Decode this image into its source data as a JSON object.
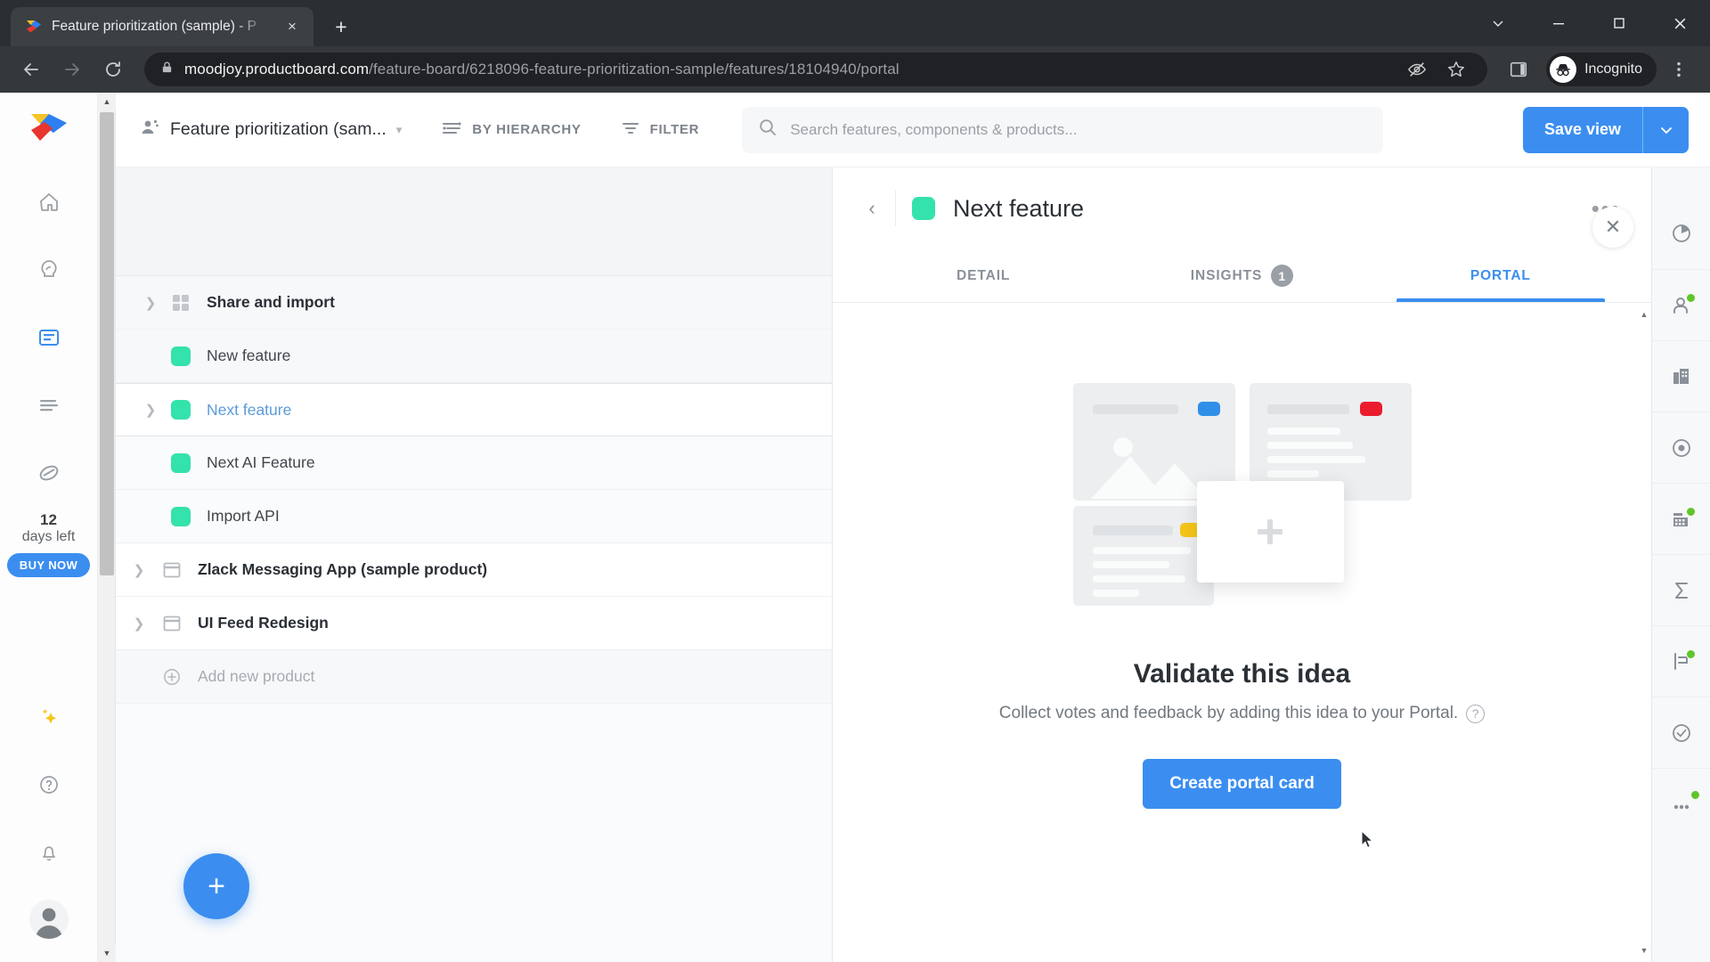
{
  "browser": {
    "tab": {
      "title": "Feature prioritization (sample) - P",
      "favicon": "productboard-favicon",
      "close": "×"
    },
    "newtab_label": "+",
    "window_controls": {
      "minimize_group": "⌄",
      "minimize": "–",
      "maximize": "❐",
      "close": "✕"
    },
    "nav": {
      "back": "←",
      "forward": "→",
      "reload": "⟳"
    },
    "omnibox": {
      "lock_icon": "lock-icon",
      "url_host": "moodjoy.productboard.com",
      "url_path": "/feature-board/6218096-feature-prioritization-sample/features/18104940/portal"
    },
    "actions": {
      "no_tracking": "no-tracking-icon",
      "bookmark": "☆",
      "side_panel": "side-panel-icon",
      "menu": "⋮"
    },
    "profile": {
      "name": "Incognito",
      "avatar": "incognito-avatar"
    }
  },
  "left_rail": {
    "brand": "productboard-logo",
    "items": [
      {
        "name": "home",
        "active": false
      },
      {
        "name": "insights",
        "active": false
      },
      {
        "name": "features",
        "active": true
      },
      {
        "name": "roadmap",
        "active": false
      },
      {
        "name": "objectives",
        "active": false
      }
    ],
    "trial": {
      "days": "12",
      "label": "days left",
      "cta": "BUY NOW"
    },
    "bottom": [
      {
        "name": "ai-sparkle"
      },
      {
        "name": "help"
      },
      {
        "name": "notifications"
      },
      {
        "name": "user-avatar"
      }
    ]
  },
  "topbar": {
    "view_name": "Feature prioritization (sam...",
    "view_caret": "▾",
    "hierarchy_label": "BY HIERARCHY",
    "filter_label": "FILTER",
    "search_placeholder": "Search features, components & products...",
    "save_label": "Save view",
    "save_caret": "⌄"
  },
  "board": {
    "rows": [
      {
        "label": "Share and import",
        "type": "component",
        "caret": true,
        "bold": true,
        "selected": false
      },
      {
        "label": "New feature",
        "type": "feature",
        "caret": false,
        "bold": false,
        "selected": false
      },
      {
        "label": "Next feature",
        "type": "feature",
        "caret": true,
        "bold": false,
        "selected": true
      },
      {
        "label": "Next AI Feature",
        "type": "feature",
        "caret": false,
        "bold": false,
        "selected": false
      },
      {
        "label": "Import API",
        "type": "feature",
        "caret": false,
        "bold": false,
        "selected": false
      },
      {
        "label": "Zlack Messaging App (sample product)",
        "type": "product",
        "caret": true,
        "bold": true,
        "selected": false
      },
      {
        "label": "UI Feed Redesign",
        "type": "product",
        "caret": true,
        "bold": true,
        "selected": false
      },
      {
        "label": "Add new product",
        "type": "add",
        "caret": false,
        "bold": false,
        "selected": false
      }
    ],
    "add_feature_fab": "+"
  },
  "panel": {
    "back": "‹",
    "title": "Next feature",
    "more": "•••",
    "close": "✕",
    "tabs": [
      {
        "label": "DETAIL",
        "badge": "",
        "active": false
      },
      {
        "label": "INSIGHTS",
        "badge": "1",
        "active": false
      },
      {
        "label": "PORTAL",
        "badge": "",
        "active": true
      }
    ],
    "empty_state": {
      "title": "Validate this idea",
      "subtitle": "Collect votes and feedback by adding this idea to your Portal.",
      "help_icon": "?",
      "cta": "Create portal card"
    }
  },
  "right_rail": {
    "items": [
      {
        "name": "pie-chart-icon",
        "dot": false
      },
      {
        "name": "user-insight-icon",
        "dot": true
      },
      {
        "name": "company-icon",
        "dot": false
      },
      {
        "name": "objective-icon",
        "dot": false
      },
      {
        "name": "grid-data-icon",
        "dot": true
      },
      {
        "name": "sigma-icon",
        "dot": false
      },
      {
        "name": "chart-growth-icon",
        "dot": true
      },
      {
        "name": "check-circle-icon",
        "dot": false
      },
      {
        "name": "more-dots-icon",
        "dot": true
      }
    ]
  },
  "colors": {
    "accent_blue": "#3b8ef0",
    "feature_green": "#34e2ac",
    "badge_green": "#5ec62b",
    "illustration_blue": "#2f8fe8",
    "illustration_red": "#ea1c2d",
    "illustration_yellow": "#f5c518"
  }
}
